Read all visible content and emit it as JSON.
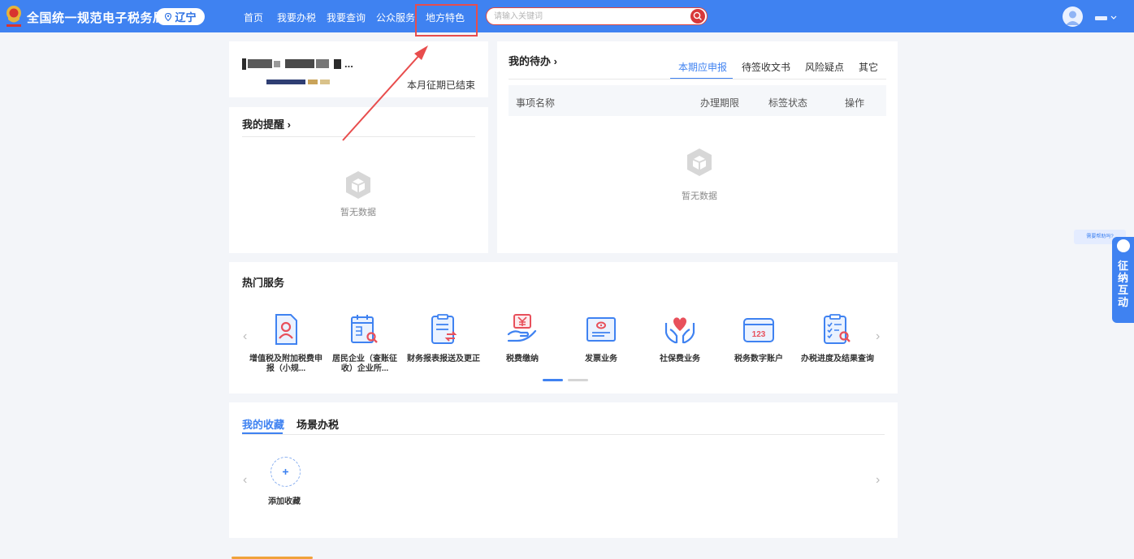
{
  "header": {
    "brand": "全国统一规范电子税务局",
    "region": "辽宁",
    "nav": [
      "首页",
      "我要办税",
      "我要查询",
      "公众服务",
      "地方特色"
    ],
    "search_placeholder": "请输入关键词"
  },
  "company": {
    "name_suffix": "...",
    "period_status": "本月征期已结束"
  },
  "reminder": {
    "title": "我的提醒 ›",
    "empty": "暂无数据"
  },
  "todo": {
    "title": "我的待办 ›",
    "tabs": [
      "本期应申报",
      "待签收文书",
      "风险疑点",
      "其它"
    ],
    "columns": [
      "事项名称",
      "办理期限",
      "标签状态",
      "操作"
    ],
    "empty": "暂无数据"
  },
  "hot": {
    "title": "热门服务",
    "services": [
      {
        "label": "增值税及附加税费申报（小规...",
        "icon": "person-document-icon"
      },
      {
        "label": "居民企业（查账征收）企业所...",
        "icon": "calendar-search-icon"
      },
      {
        "label": "财务报表报送及更正",
        "icon": "report-exchange-icon"
      },
      {
        "label": "税费缴纳",
        "icon": "yuan-hand-icon"
      },
      {
        "label": "发票业务",
        "icon": "invoice-icon"
      },
      {
        "label": "社保费业务",
        "icon": "heart-hands-icon"
      },
      {
        "label": "税务数字账户",
        "icon": "digital-account-icon"
      },
      {
        "label": "办税进度及结果查询",
        "icon": "checklist-search-icon"
      }
    ],
    "prev": "‹",
    "next": "›"
  },
  "favorites": {
    "tabs": [
      "我的收藏",
      "场景办税"
    ],
    "add_label": "添加收藏",
    "prev": "‹",
    "next": "›"
  },
  "side": {
    "help_tip": "需要帮助吗?",
    "interact_label": "征\n纳\n互\n动"
  },
  "colors": {
    "brand_blue": "#3f82f1",
    "highlight_red": "#e84d4d",
    "icon_red": "#e8505b"
  }
}
